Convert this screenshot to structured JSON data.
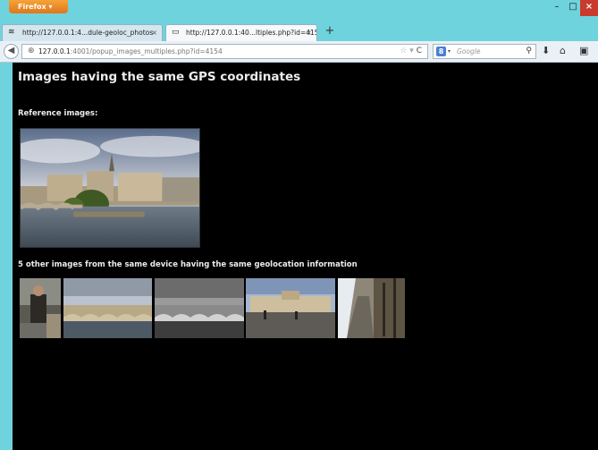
{
  "browser": {
    "app_button_label": "Firefox ▾",
    "window_controls": {
      "minimize": "–",
      "maximize": "□",
      "close": "×"
    },
    "tabs": [
      {
        "title": "http://127.0.0.1:4...dule-geoloc_photos",
        "close": "×",
        "active": false
      },
      {
        "title": "http://127.0.0.1:40...ltiples.php?id=4154",
        "close": "×",
        "active": true
      }
    ],
    "new_tab_label": "+",
    "url": {
      "host": "127.0.0.1",
      "rest": ":4001/popup_images_multiples.php?id=4154"
    },
    "search": {
      "engine_badge": "8",
      "placeholder": "Google"
    }
  },
  "page": {
    "title": "Images having the same GPS coordinates",
    "reference_label": "Reference images:",
    "others_label": "5 other images from the same device having the same geolocation information",
    "reference_image": "photo-ile-de-la-cite",
    "thumbnails": [
      {
        "name": "photo-person-seated"
      },
      {
        "name": "photo-pont-neuf"
      },
      {
        "name": "photo-pont-neuf-grayscale"
      },
      {
        "name": "photo-quai-buildings"
      },
      {
        "name": "photo-riverbank-trees"
      }
    ]
  },
  "colors": {
    "window_frame": "#6fd3dd",
    "page_background": "#000000",
    "page_text": "#ececec",
    "close_button": "#c93b2c",
    "firefox_button": "#e8801f"
  }
}
